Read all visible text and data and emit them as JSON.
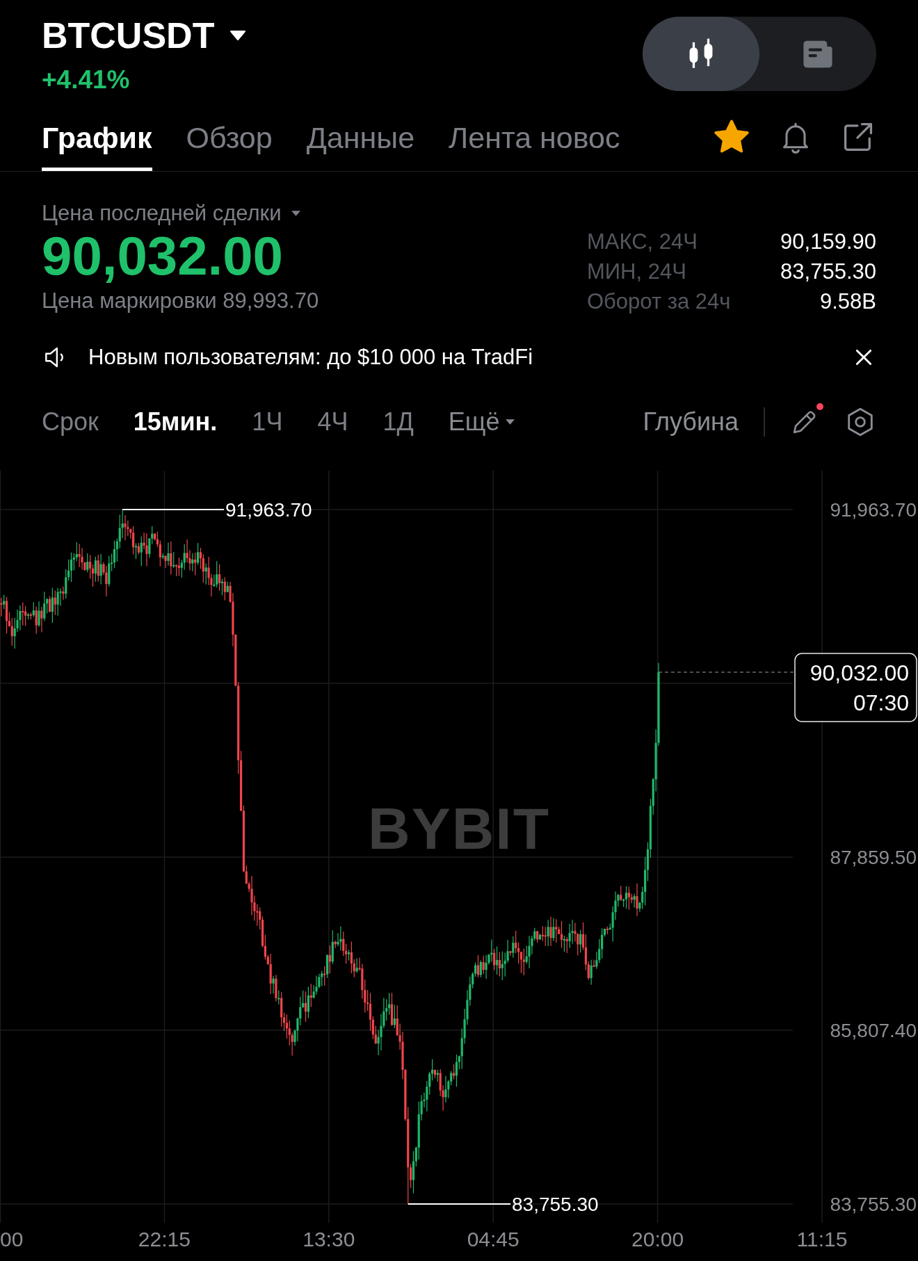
{
  "header": {
    "symbol": "BTCUSDT",
    "change": "+4.41%",
    "view_toggle": [
      {
        "kind": "chart",
        "selected": true
      },
      {
        "kind": "news",
        "selected": false
      }
    ]
  },
  "tabs": [
    {
      "label": "График",
      "selected": true
    },
    {
      "label": "Обзор",
      "selected": false
    },
    {
      "label": "Данные",
      "selected": false
    },
    {
      "label": "Лента новос",
      "selected": false
    }
  ],
  "actions": {
    "favorite": true
  },
  "price": {
    "label": "Цена последней сделки",
    "last": "90,032.00",
    "mark": "Цена маркировки 89,993.70"
  },
  "stats": [
    {
      "label": "МАКС, 24Ч",
      "value": "90,159.90"
    },
    {
      "label": "МИН, 24Ч",
      "value": "83,755.30"
    },
    {
      "label": "Оборот за 24ч",
      "value": "9.58B"
    }
  ],
  "announcement": {
    "text": "Новым пользователям: до $10 000 на TradFi"
  },
  "toolbar": {
    "label": "Срок",
    "intervals": [
      {
        "label": "15мин.",
        "selected": true
      },
      {
        "label": "1Ч",
        "selected": false
      },
      {
        "label": "4Ч",
        "selected": false
      },
      {
        "label": "1Д",
        "selected": false
      }
    ],
    "more": "Ещё",
    "depth": "Глубина",
    "drawing_badge": true
  },
  "chart": {
    "watermark": "BYBIT",
    "y_axis": [
      "91,963.70",
      "87,859.50",
      "85,807.40",
      "83,755.30"
    ],
    "x_axis": [
      "00",
      "22:15",
      "13:30",
      "04:45",
      "20:00",
      "11:15"
    ],
    "high_marker": "91,963.70",
    "low_marker": "83,755.30",
    "last_price": {
      "price": "90,032.00",
      "countdown": "07:30"
    }
  }
}
